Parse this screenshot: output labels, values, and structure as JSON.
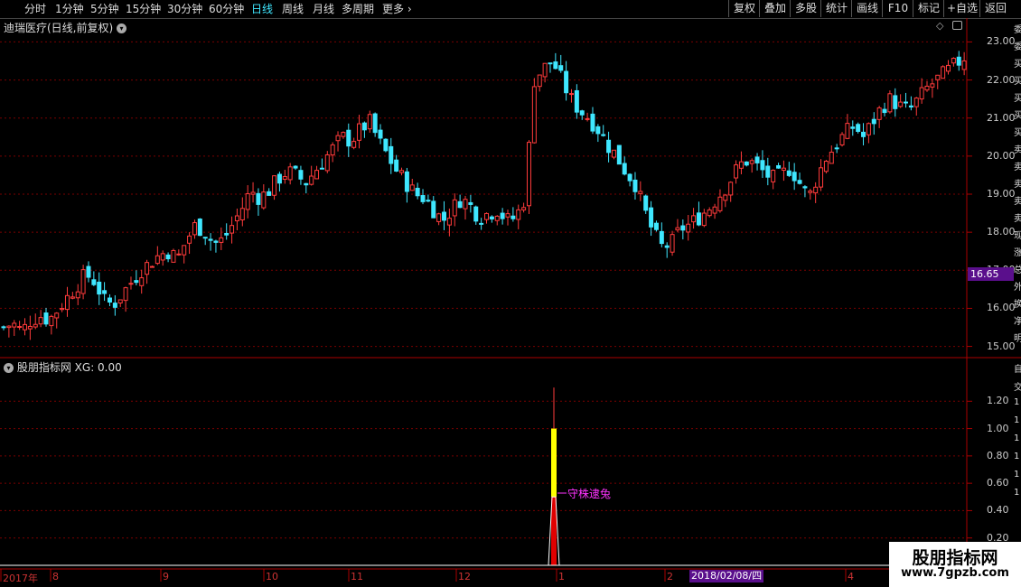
{
  "toolbar": {
    "periods": [
      "分时",
      "1分钟",
      "5分钟",
      "15分钟",
      "30分钟",
      "60分钟",
      "日线",
      "周线",
      "月线",
      "多周期",
      "更多"
    ],
    "active_index": 6,
    "right_buttons": [
      "复权",
      "叠加",
      "多股",
      "统计",
      "画线",
      "F10",
      "标记",
      "+自选",
      "返回"
    ]
  },
  "main": {
    "title": "迪瑞医疗(日线,前复权)",
    "current_price": "16.65",
    "right_stub": [
      "委",
      "委",
      "买",
      "买",
      "买",
      "买",
      "买",
      "卖",
      "卖",
      "卖",
      "卖",
      "卖",
      "现",
      "涨",
      "总",
      "外",
      "换",
      "净",
      "明"
    ]
  },
  "indicator": {
    "title": "股朋指标网",
    "value_text": "XG: 0.00",
    "signal_text": "守株逮兔",
    "right_stub": [
      "自",
      "交",
      "1",
      "1",
      "1",
      "1",
      "1",
      "1"
    ]
  },
  "xaxis": {
    "labels": [
      "2017年",
      "8",
      "9",
      "10",
      "11",
      "12",
      "1",
      "2",
      "4"
    ],
    "cursor_date": "2018/02/08/四"
  },
  "watermark": {
    "line1": "股朋指标网",
    "line2": "www.7gpzb.com"
  },
  "colors": {
    "up": "#ff3b3b",
    "down": "#3fe7ff",
    "grid": "#7a0000",
    "accent": "#5a0f8c",
    "signal": "#ffff00"
  },
  "chart_data": [
    {
      "type": "candlestick",
      "title": "迪瑞医疗(日线,前复权)",
      "ylim": [
        14.8,
        23.2
      ],
      "yticks": [
        15.0,
        16.0,
        17.0,
        18.0,
        19.0,
        20.0,
        21.0,
        22.0,
        23.0
      ],
      "close_trend": [
        15.5,
        15.6,
        15.4,
        15.7,
        15.8,
        15.7,
        16.0,
        16.3,
        16.6,
        16.9,
        16.7,
        16.2,
        16.1,
        16.4,
        16.7,
        17.0,
        17.2,
        17.4,
        17.5,
        17.3,
        17.8,
        18.2,
        18.0,
        17.7,
        17.8,
        18.2,
        18.6,
        19.1,
        18.9,
        19.1,
        19.4,
        19.6,
        19.5,
        19.3,
        19.6,
        19.9,
        20.2,
        20.5,
        20.4,
        20.7,
        20.9,
        20.4,
        20.0,
        19.6,
        19.3,
        19.0,
        18.9,
        18.6,
        18.3,
        18.6,
        18.9,
        18.7,
        18.4,
        18.5,
        18.6,
        18.3,
        18.4,
        18.9,
        22.0,
        22.3,
        22.5,
        22.0,
        21.5,
        21.2,
        21.0,
        20.7,
        20.3,
        20.0,
        19.6,
        19.3,
        18.6,
        18.0,
        17.6,
        17.7,
        18.1,
        18.2,
        18.4,
        18.6,
        18.9,
        19.2,
        19.6,
        19.9,
        19.8,
        19.6,
        19.4,
        19.5,
        19.7,
        19.3,
        18.9,
        19.5,
        20.0,
        20.3,
        20.6,
        20.8,
        20.5,
        20.9,
        21.3,
        21.5,
        21.3,
        21.2,
        21.5,
        21.8,
        22.0,
        22.2,
        22.4,
        22.6
      ]
    },
    {
      "type": "bar",
      "title": "股朋指标网",
      "ylim": [
        0,
        1.4
      ],
      "yticks": [
        0.2,
        0.4,
        0.6,
        0.8,
        1.0,
        1.2
      ],
      "signal_index": 58,
      "signal_value": 1.0,
      "spike_value": 1.3,
      "red_value": 0.5
    }
  ]
}
